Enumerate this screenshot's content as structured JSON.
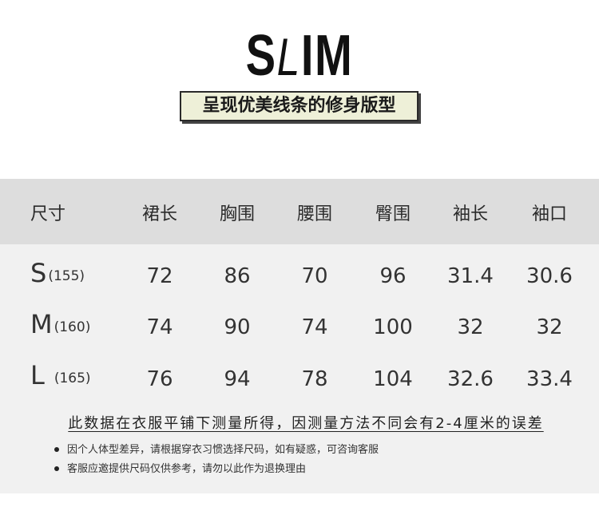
{
  "brand": {
    "logo_part1": "S",
    "logo_slash": "L",
    "logo_part2": "IM",
    "tagline": "呈现优美线条的修身版型"
  },
  "size_table": {
    "headers": [
      "尺寸",
      "裙长",
      "胸围",
      "腰围",
      "臀围",
      "袖长",
      "袖口"
    ],
    "rows": [
      {
        "size": "S",
        "code": "(155)",
        "values": [
          "72",
          "86",
          "70",
          "96",
          "31.4",
          "30.6"
        ]
      },
      {
        "size": "M",
        "code": "(160)",
        "values": [
          "74",
          "90",
          "74",
          "100",
          "32",
          "32"
        ]
      },
      {
        "size": "L",
        "code": "(165)",
        "values": [
          "76",
          "94",
          "78",
          "104",
          "32.6",
          "33.4"
        ]
      }
    ]
  },
  "notes": {
    "main": "此数据在衣服平铺下测量所得，因测量方法不同会有2-4厘米的误差",
    "bullets": [
      "因个人体型差异，请根据穿衣习惯选择尺码，如有疑惑，可咨询客服",
      "客服应邀提供尺码仅供参考，请勿以此作为退换理由"
    ]
  }
}
